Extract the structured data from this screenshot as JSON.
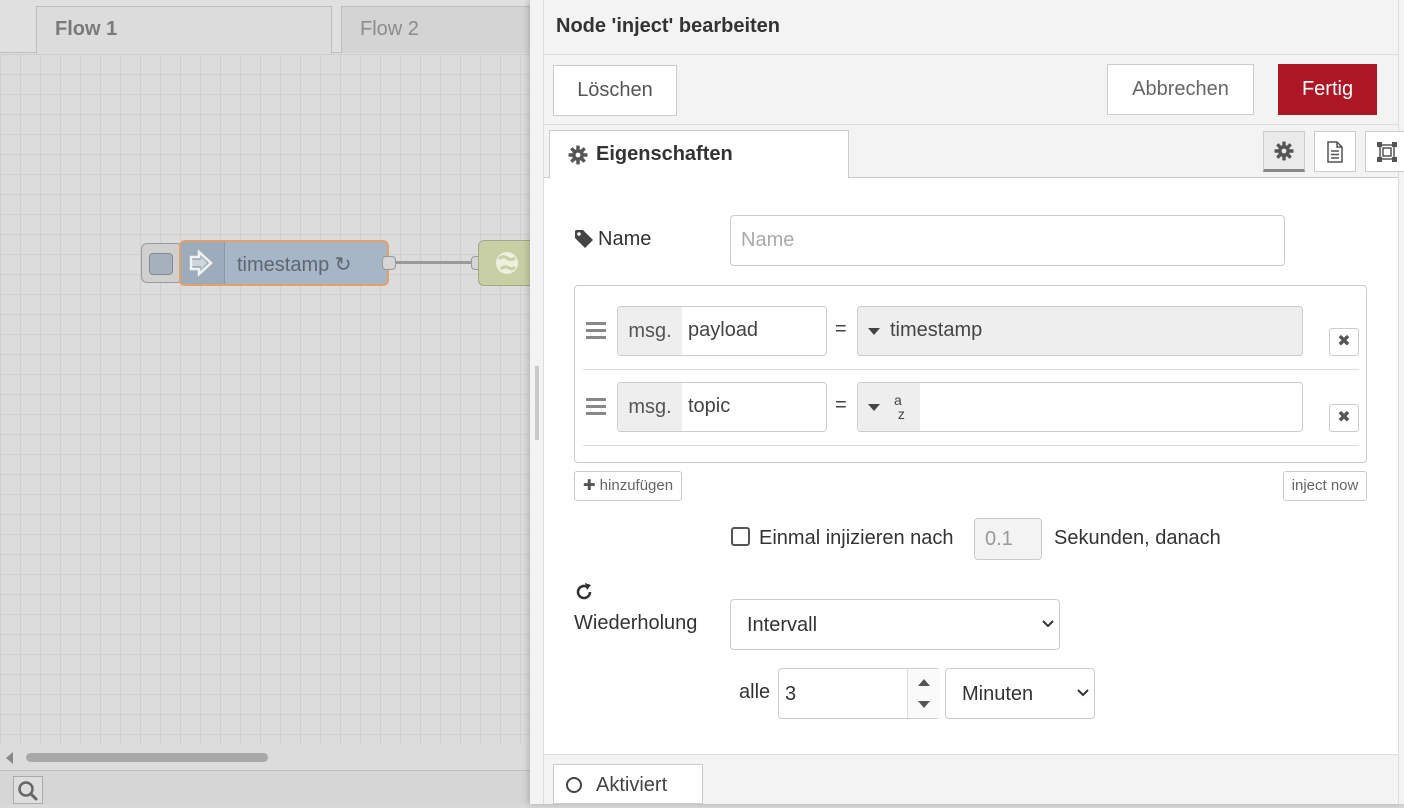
{
  "workspace": {
    "tabs": [
      {
        "label": "Flow 1",
        "active": true
      },
      {
        "label": "Flow 2",
        "active": false
      }
    ],
    "inject_node": {
      "label": "timestamp ↻"
    }
  },
  "tray": {
    "title": "Node 'inject' bearbeiten",
    "buttons": {
      "delete": "Löschen",
      "cancel": "Abbrechen",
      "done": "Fertig"
    },
    "tabs": {
      "properties": "Eigenschaften"
    },
    "accent_color": "#ad1625"
  },
  "form": {
    "name": {
      "label": "Name",
      "placeholder": "Name",
      "value": ""
    },
    "properties": [
      {
        "prefix": "msg.",
        "property": "payload",
        "equals": "=",
        "type_icon": "caret-down",
        "value": "timestamp"
      },
      {
        "prefix": "msg.",
        "property": "topic",
        "equals": "=",
        "type_icon": "string-az",
        "type_glyph_top": "a",
        "type_glyph_bottom": "z",
        "value": ""
      }
    ],
    "add_button": "hinzufügen",
    "inject_now_button": "inject now",
    "once": {
      "checked": false,
      "label": "Einmal injizieren nach",
      "delay": "0.1",
      "suffix": "Sekunden, danach"
    },
    "repeat": {
      "label": "Wiederholung",
      "mode": "Intervall",
      "every_label": "alle",
      "interval": "3",
      "unit": "Minuten"
    }
  },
  "footer": {
    "status": "Aktiviert"
  }
}
